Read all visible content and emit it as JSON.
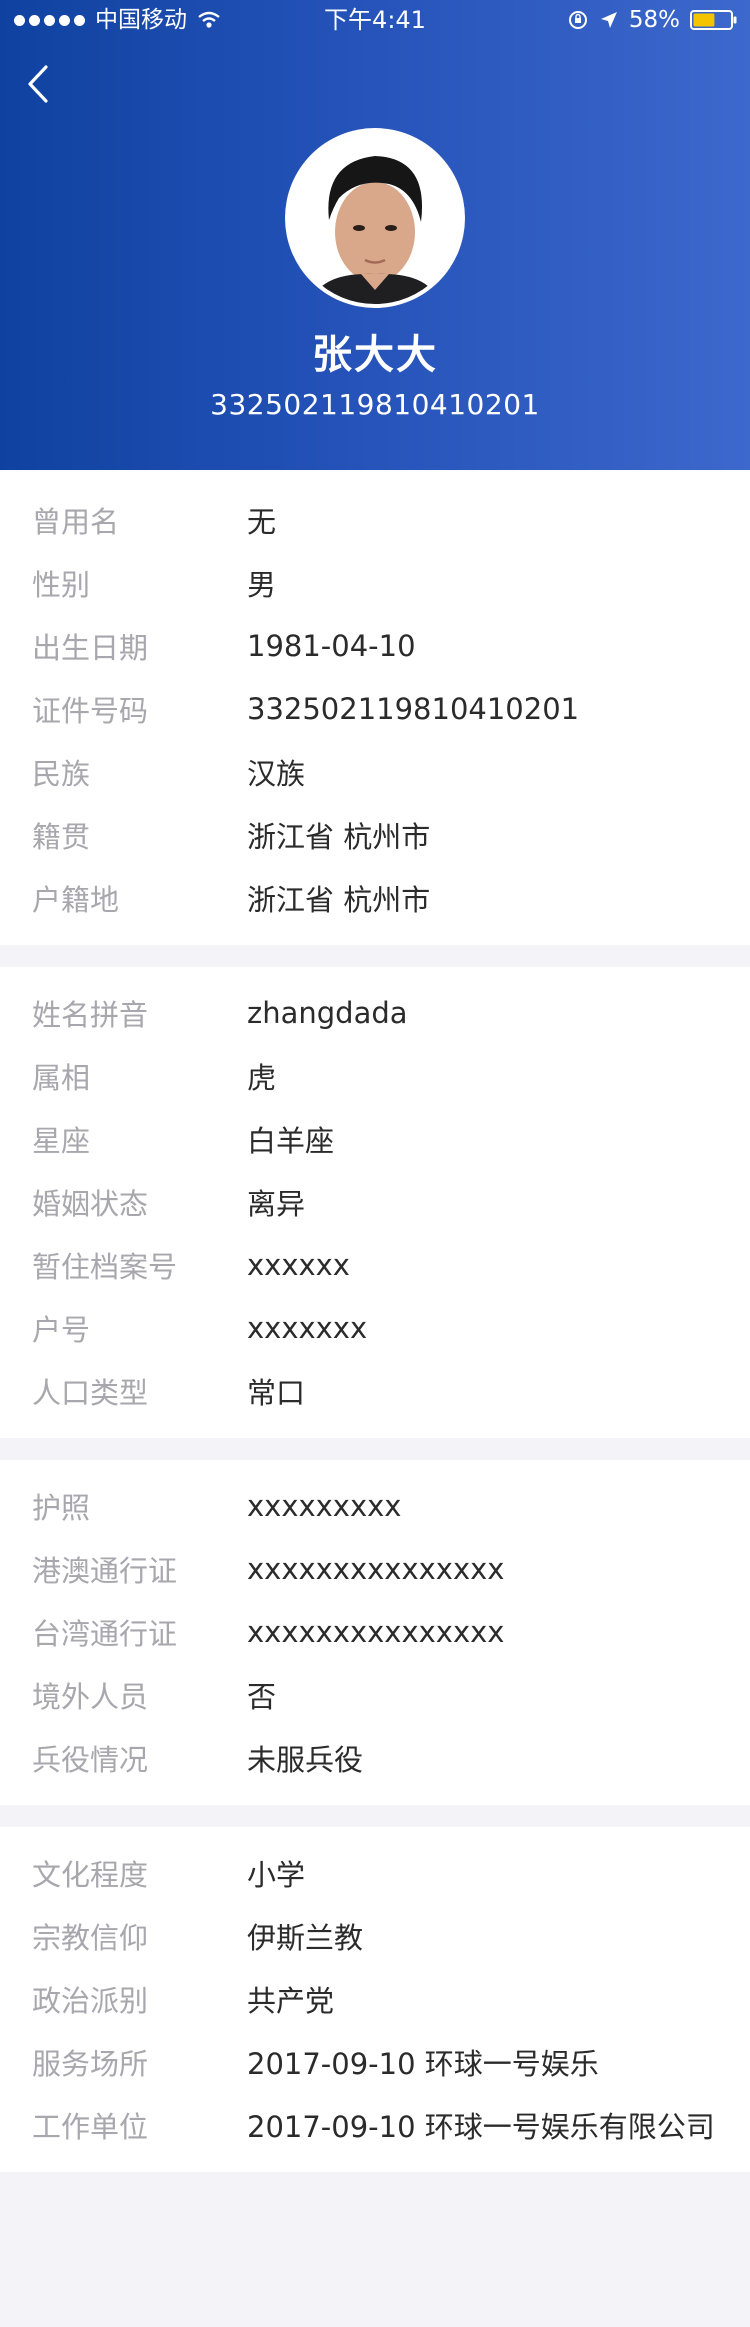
{
  "status_bar": {
    "carrier": "中国移动",
    "time": "下午4:41",
    "battery_percent": "58%",
    "battery_level": 0.58,
    "battery_color": "#f5c400"
  },
  "profile": {
    "name": "张大大",
    "id_number": "332502119810410201"
  },
  "sections": [
    {
      "rows": [
        {
          "label": "曾用名",
          "value": "无"
        },
        {
          "label": "性别",
          "value": "男"
        },
        {
          "label": "出生日期",
          "value": "1981-04-10"
        },
        {
          "label": "证件号码",
          "value": "332502119810410201"
        },
        {
          "label": "民族",
          "value": "汉族"
        },
        {
          "label": "籍贯",
          "value": "浙江省 杭州市"
        },
        {
          "label": "户籍地",
          "value": "浙江省 杭州市"
        }
      ]
    },
    {
      "rows": [
        {
          "label": "姓名拼音",
          "value": "zhangdada"
        },
        {
          "label": "属相",
          "value": "虎"
        },
        {
          "label": "星座",
          "value": "白羊座"
        },
        {
          "label": "婚姻状态",
          "value": "离异"
        },
        {
          "label": "暂住档案号",
          "value": "xxxxxx"
        },
        {
          "label": "户号",
          "value": "xxxxxxx"
        },
        {
          "label": "人口类型",
          "value": "常口"
        }
      ]
    },
    {
      "rows": [
        {
          "label": "护照",
          "value": "xxxxxxxxx"
        },
        {
          "label": "港澳通行证",
          "value": "xxxxxxxxxxxxxxx"
        },
        {
          "label": "台湾通行证",
          "value": "xxxxxxxxxxxxxxx"
        },
        {
          "label": "境外人员",
          "value": "否"
        },
        {
          "label": "兵役情况",
          "value": "未服兵役"
        }
      ]
    },
    {
      "rows": [
        {
          "label": "文化程度",
          "value": "小学"
        },
        {
          "label": "宗教信仰",
          "value": "伊斯兰教"
        },
        {
          "label": "政治派别",
          "value": "共产党"
        },
        {
          "label": "服务场所",
          "value": "2017-09-10  环球一号娱乐"
        },
        {
          "label": "工作单位",
          "value": "2017-09-10  环球一号娱乐有限公司"
        }
      ]
    }
  ],
  "icons": [
    "wifi-icon",
    "lock-rotation-icon",
    "location-arrow-icon",
    "battery-icon",
    "back-arrow-icon"
  ]
}
